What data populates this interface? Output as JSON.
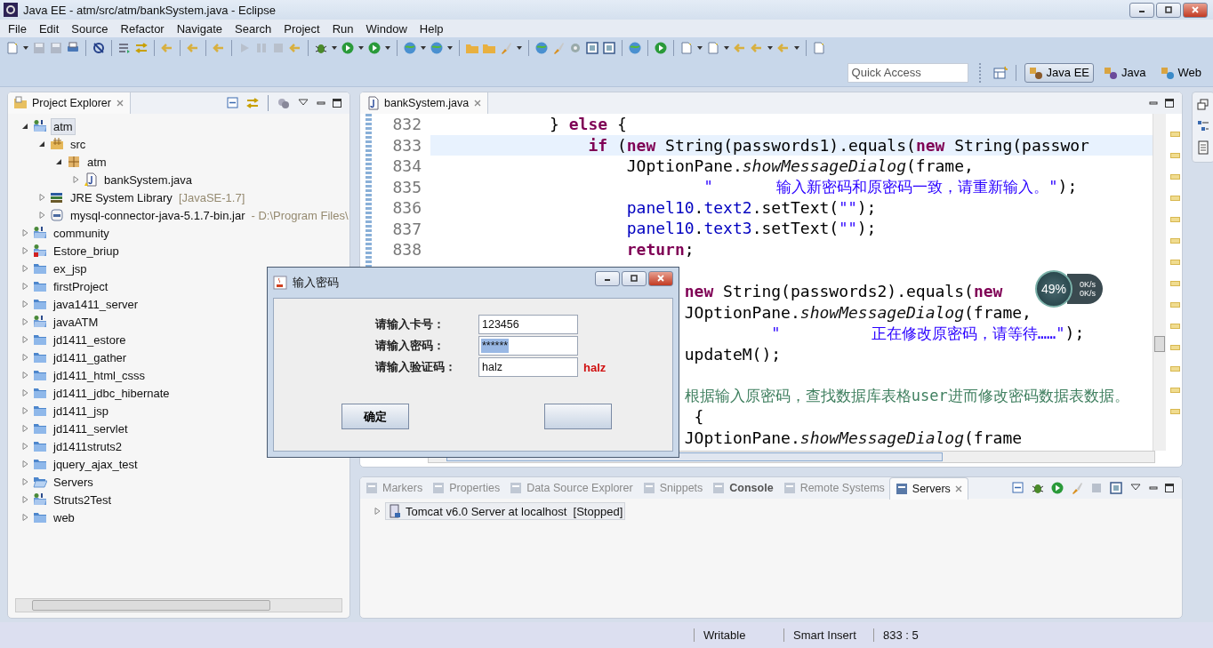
{
  "window": {
    "title": "Java EE - atm/src/atm/bankSystem.java - Eclipse"
  },
  "menu": [
    "File",
    "Edit",
    "Source",
    "Refactor",
    "Navigate",
    "Search",
    "Project",
    "Run",
    "Window",
    "Help"
  ],
  "quick_access": {
    "placeholder": "Quick Access"
  },
  "perspectives": [
    {
      "label": "Java EE",
      "selected": true
    },
    {
      "label": "Java",
      "selected": false
    },
    {
      "label": "Web",
      "selected": false
    }
  ],
  "project_explorer": {
    "title": "Project Explorer",
    "tree": [
      {
        "label": "atm",
        "kind": "java-project",
        "selected": true,
        "expanded": true,
        "children": [
          {
            "label": "src",
            "kind": "source-folder",
            "selected": false,
            "expanded": true,
            "children": [
              {
                "label": "atm",
                "kind": "package",
                "selected": false,
                "expanded": true,
                "children": [
                  {
                    "label": "bankSystem.java",
                    "kind": "java-file",
                    "selected": false,
                    "expanded": false
                  }
                ]
              }
            ]
          },
          {
            "label": "JRE System Library",
            "decoration": "[JavaSE-1.7]",
            "kind": "library",
            "selected": false,
            "expanded": false
          },
          {
            "label": "mysql-connector-java-5.1.7-bin.jar",
            "decoration": "- D:\\Program Files\\",
            "kind": "jar",
            "selected": false,
            "expanded": false
          }
        ]
      },
      {
        "label": "community",
        "kind": "java-project",
        "selected": false,
        "expanded": false
      },
      {
        "label": "Estore_briup",
        "kind": "error-project",
        "selected": false,
        "expanded": false
      },
      {
        "label": "ex_jsp",
        "kind": "folder",
        "selected": false,
        "expanded": false
      },
      {
        "label": "firstProject",
        "kind": "folder",
        "selected": false,
        "expanded": false
      },
      {
        "label": "java1411_server",
        "kind": "folder",
        "selected": false,
        "expanded": false
      },
      {
        "label": "javaATM",
        "kind": "java-project",
        "selected": false,
        "expanded": false
      },
      {
        "label": "jd1411_estore",
        "kind": "folder",
        "selected": false,
        "expanded": false
      },
      {
        "label": "jd1411_gather",
        "kind": "folder",
        "selected": false,
        "expanded": false
      },
      {
        "label": "jd1411_html_csss",
        "kind": "folder",
        "selected": false,
        "expanded": false
      },
      {
        "label": "jd1411_jdbc_hibernate",
        "kind": "folder",
        "selected": false,
        "expanded": false
      },
      {
        "label": "jd1411_jsp",
        "kind": "folder",
        "selected": false,
        "expanded": false
      },
      {
        "label": "jd1411_servlet",
        "kind": "folder",
        "selected": false,
        "expanded": false
      },
      {
        "label": "jd1411struts2",
        "kind": "folder",
        "selected": false,
        "expanded": false
      },
      {
        "label": "jquery_ajax_test",
        "kind": "folder",
        "selected": false,
        "expanded": false
      },
      {
        "label": "Servers",
        "kind": "open-folder",
        "selected": false,
        "expanded": false
      },
      {
        "label": "Struts2Test",
        "kind": "java-project",
        "selected": false,
        "expanded": false
      },
      {
        "label": "web",
        "kind": "folder",
        "selected": false,
        "expanded": false
      }
    ]
  },
  "editor": {
    "tabs": [
      {
        "label": "bankSystem.java",
        "selected": true
      }
    ],
    "lines": [
      {
        "number": "832",
        "current": false,
        "segments": [
          {
            "kind": "plain",
            "text": "            } "
          },
          {
            "kind": "keyword",
            "text": "else"
          },
          {
            "kind": "plain",
            "text": " {"
          }
        ]
      },
      {
        "number": "833",
        "current": true,
        "segments": [
          {
            "kind": "keyword",
            "text": "                if"
          },
          {
            "kind": "plain",
            "text": " ("
          },
          {
            "kind": "keyword",
            "text": "new"
          },
          {
            "kind": "plain",
            "text": " String(passwords1).equals("
          },
          {
            "kind": "keyword",
            "text": "new"
          },
          {
            "kind": "plain",
            "text": " String(passwor"
          }
        ]
      },
      {
        "number": "834",
        "current": false,
        "segments": [
          {
            "kind": "plain",
            "text": "                    JOptionPane."
          },
          {
            "kind": "static",
            "text": "showMessageDialog"
          },
          {
            "kind": "plain",
            "text": "(frame,"
          }
        ]
      },
      {
        "number": "835",
        "current": false,
        "segments": [
          {
            "kind": "string",
            "text": "                            \"       输入新密码和原密码一致，请重新输入。\""
          },
          {
            "kind": "plain",
            "text": ");"
          }
        ]
      },
      {
        "number": "836",
        "current": false,
        "segments": [
          {
            "kind": "field",
            "text": "                    panel10"
          },
          {
            "kind": "plain",
            "text": "."
          },
          {
            "kind": "field",
            "text": "text2"
          },
          {
            "kind": "plain",
            "text": ".setText("
          },
          {
            "kind": "string",
            "text": "\"\""
          },
          {
            "kind": "plain",
            "text": ");"
          }
        ]
      },
      {
        "number": "837",
        "current": false,
        "segments": [
          {
            "kind": "field",
            "text": "                    panel10"
          },
          {
            "kind": "plain",
            "text": "."
          },
          {
            "kind": "field",
            "text": "text3"
          },
          {
            "kind": "plain",
            "text": ".setText("
          },
          {
            "kind": "string",
            "text": "\"\""
          },
          {
            "kind": "plain",
            "text": ");"
          }
        ]
      },
      {
        "number": "838",
        "current": false,
        "segments": [
          {
            "kind": "keyword",
            "text": "                    return"
          },
          {
            "kind": "plain",
            "text": ";"
          }
        ]
      },
      {
        "current": false
      },
      {
        "current": false,
        "segments": [
          {
            "kind": "keyword",
            "text": "                          new"
          },
          {
            "kind": "plain",
            "text": " String(passwords2).equals("
          },
          {
            "kind": "keyword",
            "text": "new"
          }
        ]
      },
      {
        "current": false,
        "segments": [
          {
            "kind": "plain",
            "text": "                          JOptionPane."
          },
          {
            "kind": "static",
            "text": "showMessageDialog"
          },
          {
            "kind": "plain",
            "text": "(frame,"
          }
        ]
      },
      {
        "current": false,
        "segments": [
          {
            "kind": "string",
            "text": "                                   \"          正在修改原密码，请等待……\""
          },
          {
            "kind": "plain",
            "text": ");"
          }
        ]
      },
      {
        "current": false,
        "segments": [
          {
            "kind": "plain",
            "text": "                          updateM();"
          }
        ]
      },
      {
        "current": false
      },
      {
        "current": false,
        "segments": [
          {
            "kind": "comment",
            "text": "                          根据输入原密码，查找数据库表格user进而修改密码数据表数据。"
          }
        ]
      },
      {
        "current": false,
        "segments": [
          {
            "kind": "plain",
            "text": "                           {"
          }
        ]
      },
      {
        "current": false,
        "segments": [
          {
            "kind": "plain",
            "text": "                          JOptionPane."
          },
          {
            "kind": "static",
            "text": "showMessageDialog"
          },
          {
            "kind": "plain",
            "text": "(frame"
          }
        ]
      }
    ]
  },
  "dialog": {
    "title": "输入密码",
    "fields": [
      {
        "label": "请输入卡号：",
        "value": "123456",
        "text_selected": false
      },
      {
        "label": "请输入密码：",
        "value": "******",
        "text_selected": true
      },
      {
        "label": "请输入验证码：",
        "value": "halz",
        "text_selected": false
      }
    ],
    "captcha": "halz",
    "button": "确定"
  },
  "bottom_panel": {
    "tabs": [
      {
        "label": "Markers",
        "selected": false,
        "emphasized": false
      },
      {
        "label": "Properties",
        "selected": false,
        "emphasized": false
      },
      {
        "label": "Data Source Explorer",
        "selected": false,
        "emphasized": false
      },
      {
        "label": "Snippets",
        "selected": false,
        "emphasized": false
      },
      {
        "label": "Console",
        "selected": false,
        "emphasized": true
      },
      {
        "label": "Remote Systems",
        "selected": false,
        "emphasized": false
      },
      {
        "label": "Servers",
        "selected": true,
        "emphasized": false
      }
    ],
    "servers": [
      {
        "label": "Tomcat v6.0 Server at localhost  [Stopped]",
        "expanded": false
      }
    ]
  },
  "widget": {
    "percent": "49%",
    "upload": "0K/s",
    "download": "0K/s"
  },
  "status_bar": [
    "Writable",
    "Smart Insert",
    "833 : 5"
  ]
}
